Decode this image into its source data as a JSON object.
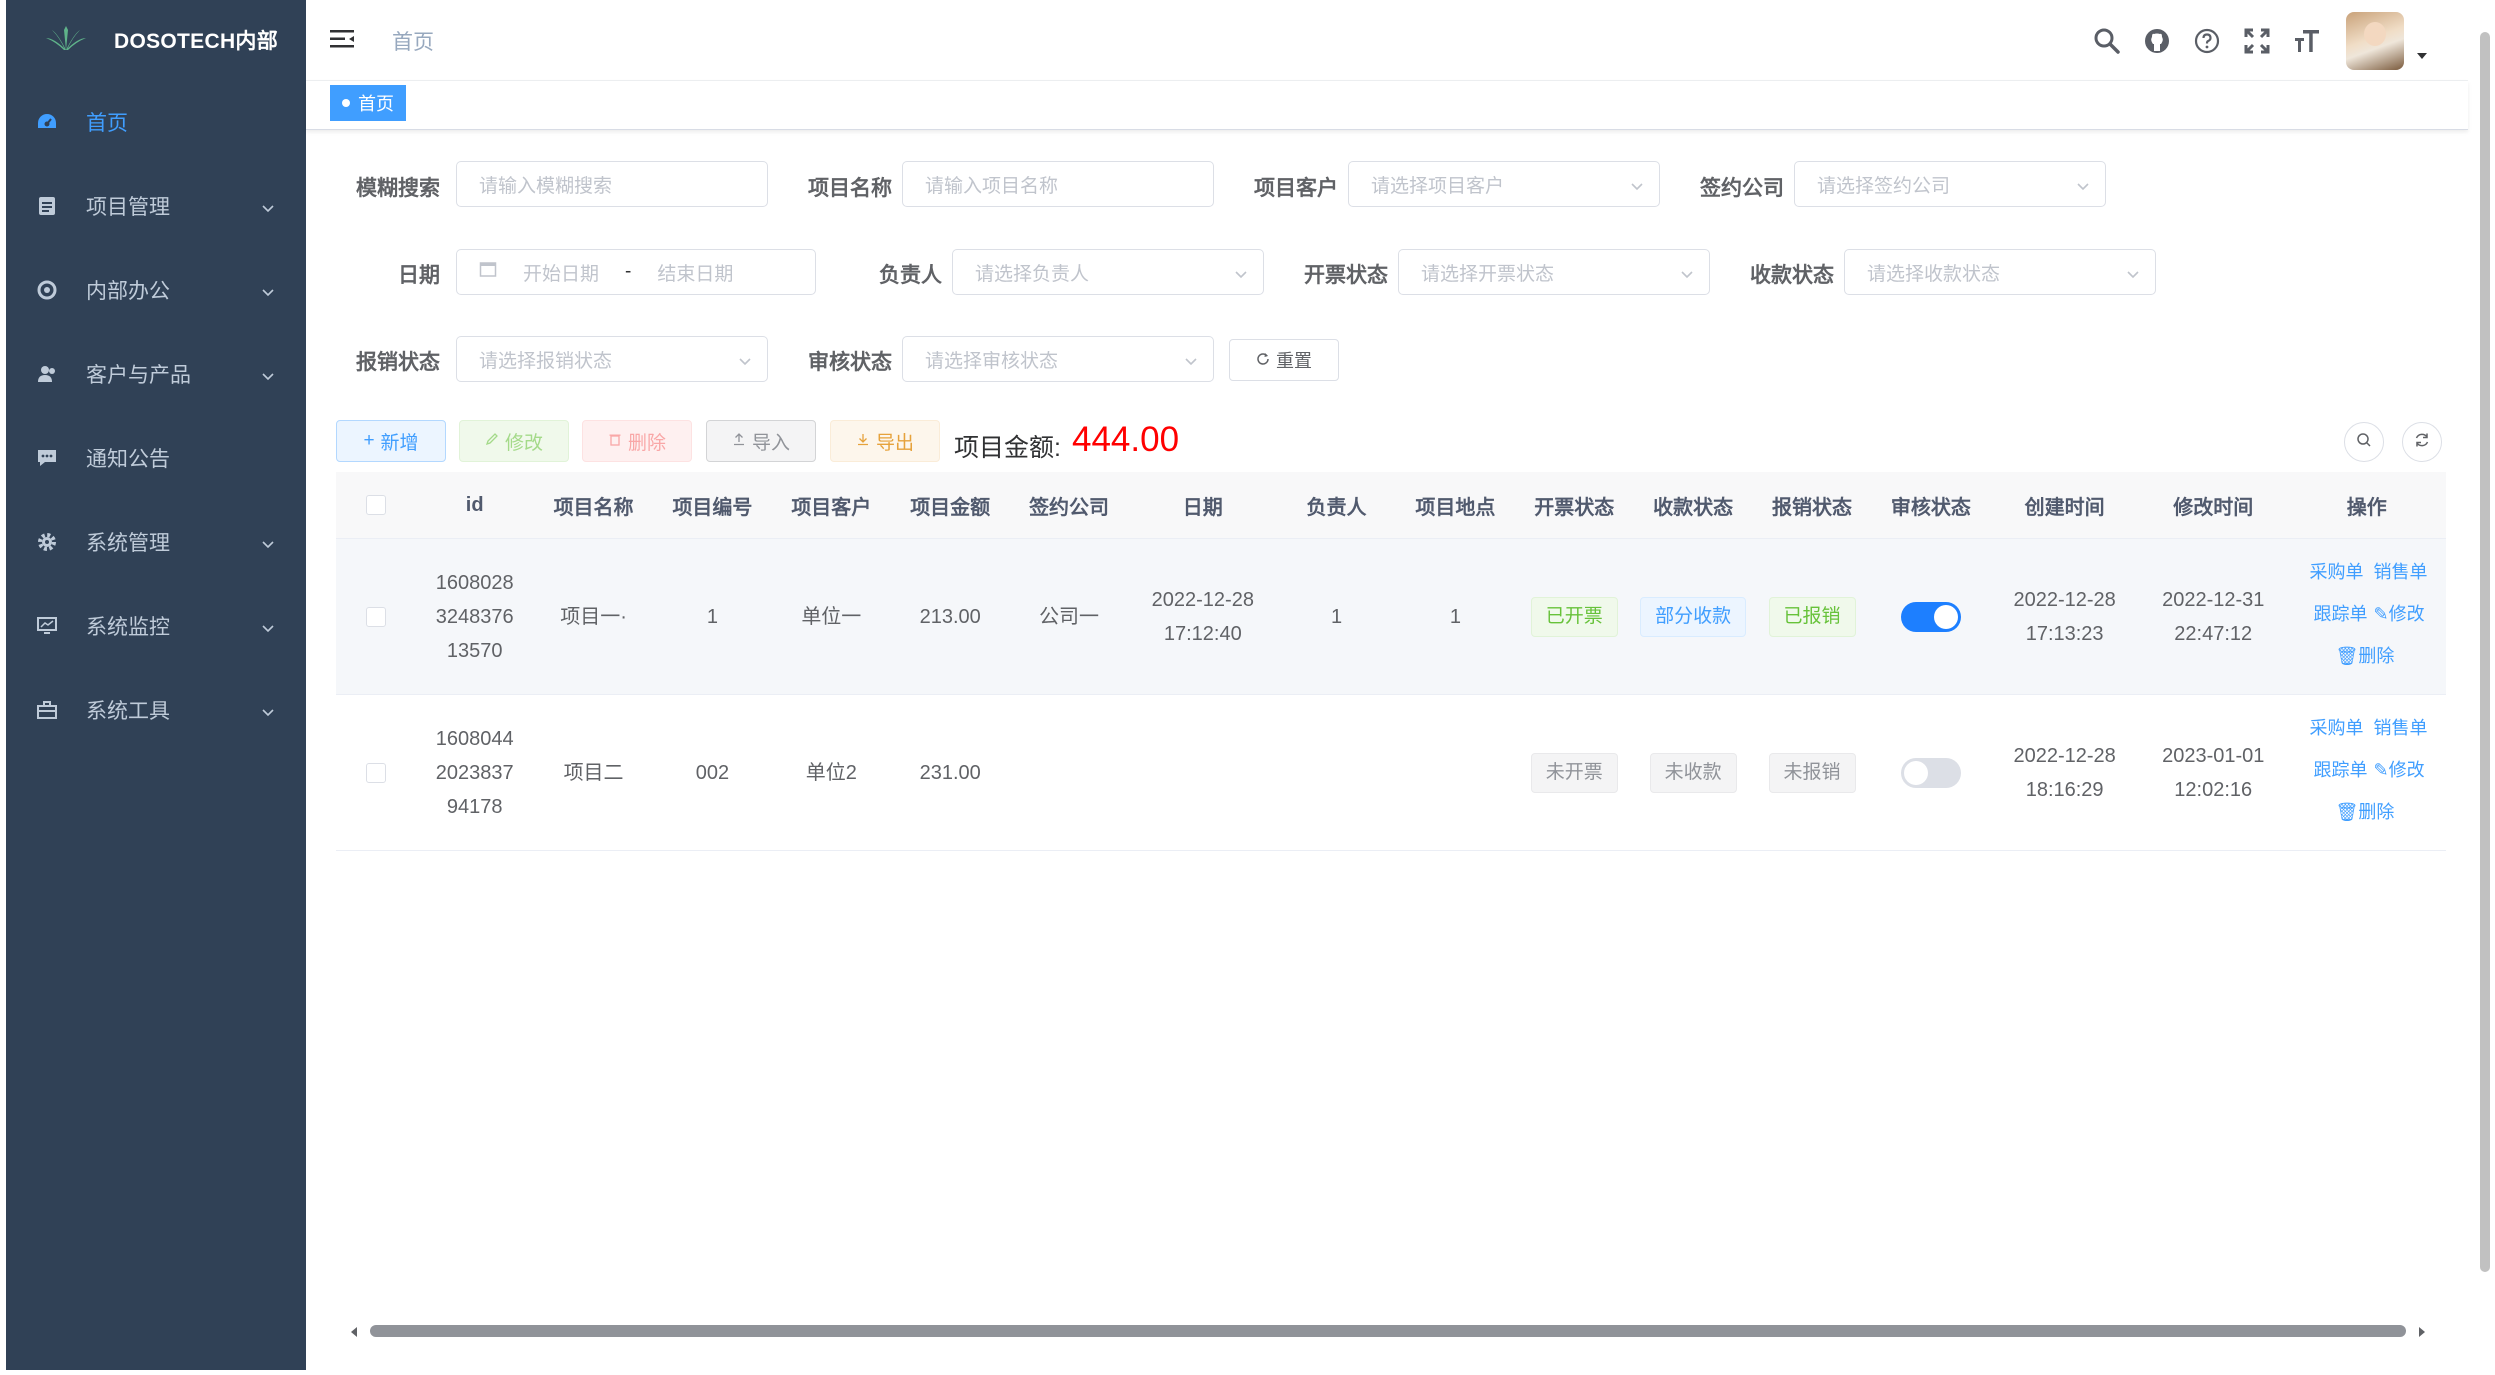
{
  "brand": {
    "title": "DOSOTECH内部"
  },
  "sidebar": {
    "items": [
      {
        "label": "首页",
        "icon": "dashboard-icon",
        "active": true
      },
      {
        "label": "项目管理",
        "icon": "document-icon"
      },
      {
        "label": "内部办公",
        "icon": "settings-ring-icon"
      },
      {
        "label": "客户与产品",
        "icon": "users-icon"
      },
      {
        "label": "通知公告",
        "icon": "message-icon"
      },
      {
        "label": "系统管理",
        "icon": "gear-icon"
      },
      {
        "label": "系统监控",
        "icon": "monitor-icon"
      },
      {
        "label": "系统工具",
        "icon": "toolbox-icon"
      }
    ]
  },
  "navbar": {
    "breadcrumb": "首页",
    "icons": [
      "search-icon",
      "github-icon",
      "help-icon",
      "fullscreen-icon",
      "font-size-icon"
    ]
  },
  "tags": {
    "active": "首页"
  },
  "filters": {
    "fuzzy": {
      "label": "模糊搜索",
      "placeholder": "请输入模糊搜索"
    },
    "project_name": {
      "label": "项目名称",
      "placeholder": "请输入项目名称"
    },
    "customer": {
      "label": "项目客户",
      "placeholder": "请选择项目客户"
    },
    "company": {
      "label": "签约公司",
      "placeholder": "请选择签约公司"
    },
    "date": {
      "label": "日期",
      "start": "开始日期",
      "sep": "-",
      "end": "结束日期"
    },
    "owner": {
      "label": "负责人",
      "placeholder": "请选择负责人"
    },
    "invoice": {
      "label": "开票状态",
      "placeholder": "请选择开票状态"
    },
    "payment": {
      "label": "收款状态",
      "placeholder": "请选择收款状态"
    },
    "reimburse": {
      "label": "报销状态",
      "placeholder": "请选择报销状态"
    },
    "audit": {
      "label": "审核状态",
      "placeholder": "请选择审核状态"
    },
    "reset": "重置"
  },
  "toolbar": {
    "add": "新增",
    "edit": "修改",
    "delete": "删除",
    "import": "导入",
    "export": "导出",
    "amount_label": "项目金额:",
    "amount_value": "444.00"
  },
  "table": {
    "headers": [
      "id",
      "项目名称",
      "项目编号",
      "项目客户",
      "项目金额",
      "签约公司",
      "日期",
      "负责人",
      "项目地点",
      "开票状态",
      "收款状态",
      "报销状态",
      "审核状态",
      "创建时间",
      "修改时间",
      "操作"
    ],
    "rows": [
      {
        "id_1": "1608028",
        "id_2": "3248376",
        "id_3": "13570",
        "name": "项目一·",
        "code": "1",
        "customer": "单位一",
        "amount": "213.00",
        "company": "公司一",
        "date_1": "2022-12-28",
        "date_2": "17:12:40",
        "owner": "1",
        "location": "1",
        "invoice": "已开票",
        "payment": "部分收款",
        "reimburse": "已报销",
        "audit_on": true,
        "created_1": "2022-12-28",
        "created_2": "17:13:23",
        "modified_1": "2022-12-31",
        "modified_2": "22:47:12",
        "op_purchase": "采购单",
        "op_sales": "销售单",
        "op_follow": "跟踪单",
        "op_edit": "修改",
        "op_delete": "删除"
      },
      {
        "id_1": "1608044",
        "id_2": "2023837",
        "id_3": "94178",
        "name": "项目二",
        "code": "002",
        "customer": "单位2",
        "amount": "231.00",
        "company": "",
        "date_1": "",
        "date_2": "",
        "owner": "",
        "location": "",
        "invoice": "未开票",
        "payment": "未收款",
        "reimburse": "未报销",
        "audit_on": false,
        "created_1": "2022-12-28",
        "created_2": "18:16:29",
        "modified_1": "2023-01-01",
        "modified_2": "12:02:16",
        "op_purchase": "采购单",
        "op_sales": "销售单",
        "op_follow": "跟踪单",
        "op_edit": "修改",
        "op_delete": "删除"
      }
    ]
  },
  "colors": {
    "sidebar": "#304156",
    "primary": "#409eff",
    "amount": "#ff0000",
    "success": "#67c23a",
    "info": "#909399"
  }
}
